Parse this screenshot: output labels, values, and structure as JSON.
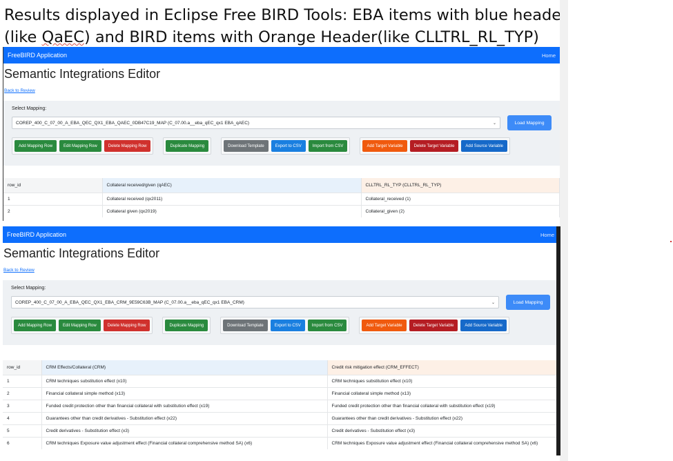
{
  "caption": {
    "line1": "Results displayed in Eclipse Free BIRD Tools: EBA items with blue header",
    "line2_a": "(like ",
    "line2_squiggle": "QaEC",
    "line2_b": ") and BIRD items with Orange Header(like CLLTRL_RL_TYP)"
  },
  "panels": [
    {
      "brand": "FreeBIRD Application",
      "home": "Home",
      "title": "Semantic Integrations Editor",
      "back": "Back to Review",
      "select_label": "Select Mapping:",
      "selected_mapping": "COREP_400_C_07_00_A_EBA_QEC_QX1_EBA_QAEC_0DB47C19_MAP (C_07.00.a__eba_qEC_qx1 EBA_qAEC)",
      "load": "Load Mapping",
      "buttons": {
        "add_row": "Add Mapping Row",
        "edit_row": "Edit Mapping Row",
        "delete_row": "Delete Mapping Row",
        "duplicate": "Duplicate Mapping",
        "download": "Download Template",
        "export": "Export to CSV",
        "import": "Import from CSV",
        "add_target": "Add Target Variable",
        "delete_target": "Delete Target Variable",
        "add_source": "Add Source Variable"
      },
      "table": {
        "headers": [
          "row_id",
          "Collateral received/given (qAEC)",
          "CLLTRL_RL_TYP (CLLTRL_RL_TYP)"
        ],
        "rows": [
          [
            "1",
            "Collateral received (qx2011)",
            "Collateral_received (1)"
          ],
          [
            "2",
            "Collateral given (qx2019)",
            "Collateral_given (2)"
          ]
        ]
      }
    },
    {
      "brand": "FreeBIRD Application",
      "home": "Home",
      "title": "Semantic Integrations Editor",
      "back": "Back to Review",
      "select_label": "Select Mapping:",
      "selected_mapping": "COREP_400_C_07_00_A_EBA_QEC_QX1_EBA_CRM_9E59C63B_MAP (C_07.00.a__eba_qEC_qx1 EBA_CRM)",
      "load": "Load Mapping",
      "buttons": {
        "add_row": "Add Mapping Row",
        "edit_row": "Edit Mapping Row",
        "delete_row": "Delete Mapping Row",
        "duplicate": "Duplicate Mapping",
        "download": "Download Template",
        "export": "Export to CSV",
        "import": "Import from CSV",
        "add_target": "Add Target Variable",
        "delete_target": "Delete Target Variable",
        "add_source": "Add Source Variable"
      },
      "table": {
        "headers": [
          "row_id",
          "CRM Effects/Collateral (CRM)",
          "Credit risk mitigation effect (CRM_EFFECT)"
        ],
        "rows": [
          [
            "1",
            "CRM techniques substitution effect (x10)",
            "CRM techniques substitution effect (x10)"
          ],
          [
            "2",
            "Financial collateral simple method (x13)",
            "Financial collateral simple method (x13)"
          ],
          [
            "3",
            "Funded credit protection other than financial collateral with substitution effect (x19)",
            "Funded credit protection other than financial collateral with substitution effect (x19)"
          ],
          [
            "4",
            "Guarantees other than credit derivatives - Substitution effect (x22)",
            "Guarantees other than credit derivatives - Substitution effect (x22)"
          ],
          [
            "5",
            "Credit derivatives - Substitution effect (x3)",
            "Credit derivatives - Substitution effect (x3)"
          ],
          [
            "6",
            "CRM techniques Exposure value adjustment effect (Financial collateral comprehensive method SA) (x6)",
            "CRM techniques Exposure value adjustment effect (Financial collateral comprehensive method SA) (x6)"
          ]
        ]
      }
    }
  ]
}
